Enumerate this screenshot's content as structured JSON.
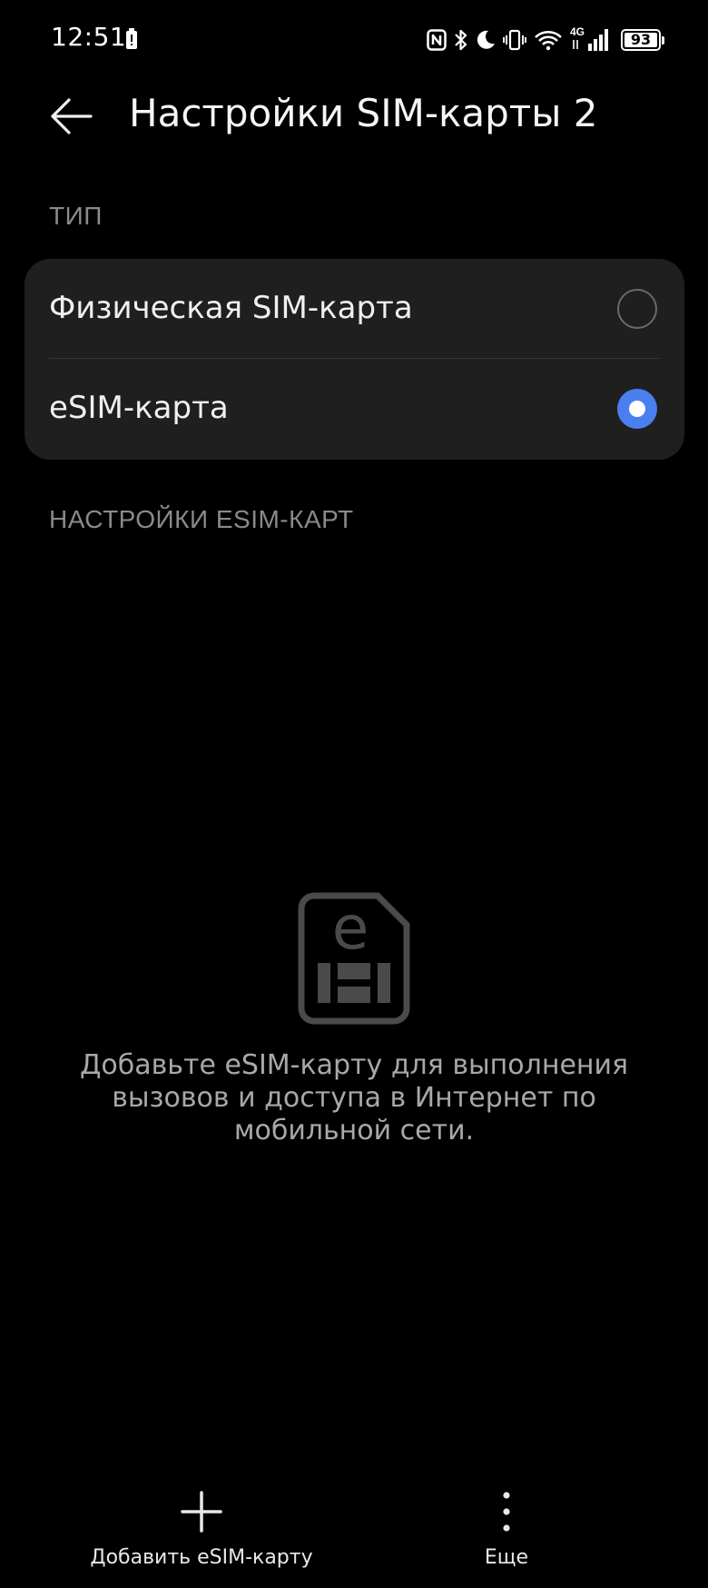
{
  "status_bar": {
    "time": "12:51",
    "battery_level": "93",
    "network_type": "4G",
    "icons": [
      "battery-saver-icon",
      "nfc-icon",
      "bluetooth-icon",
      "do-not-disturb-icon",
      "vibrate-icon",
      "wifi-icon",
      "cellular-signal-icon",
      "battery-icon"
    ]
  },
  "header": {
    "title": "Настройки SIM-карты 2",
    "back_icon": "arrow-left-icon"
  },
  "type_section": {
    "label": "ТИП",
    "options": [
      {
        "label": "Физическая SIM-карта",
        "selected": false
      },
      {
        "label": "eSIM-карта",
        "selected": true
      }
    ]
  },
  "esim_section": {
    "label": "НАСТРОЙКИ ESIM-КАРТ",
    "empty_icon": "esim-card-icon",
    "empty_text": "Добавьте eSIM-карту для выполнения вызовов и доступа в Интернет по мобильной сети."
  },
  "bottom_bar": {
    "add_label": "Добавить eSIM-карту",
    "add_icon": "plus-icon",
    "more_label": "Еще",
    "more_icon": "more-vertical-icon"
  },
  "colors": {
    "background": "#000000",
    "card": "#1f1f1f",
    "accent": "#4a7ff0",
    "section_label": "#8a8a8a"
  }
}
